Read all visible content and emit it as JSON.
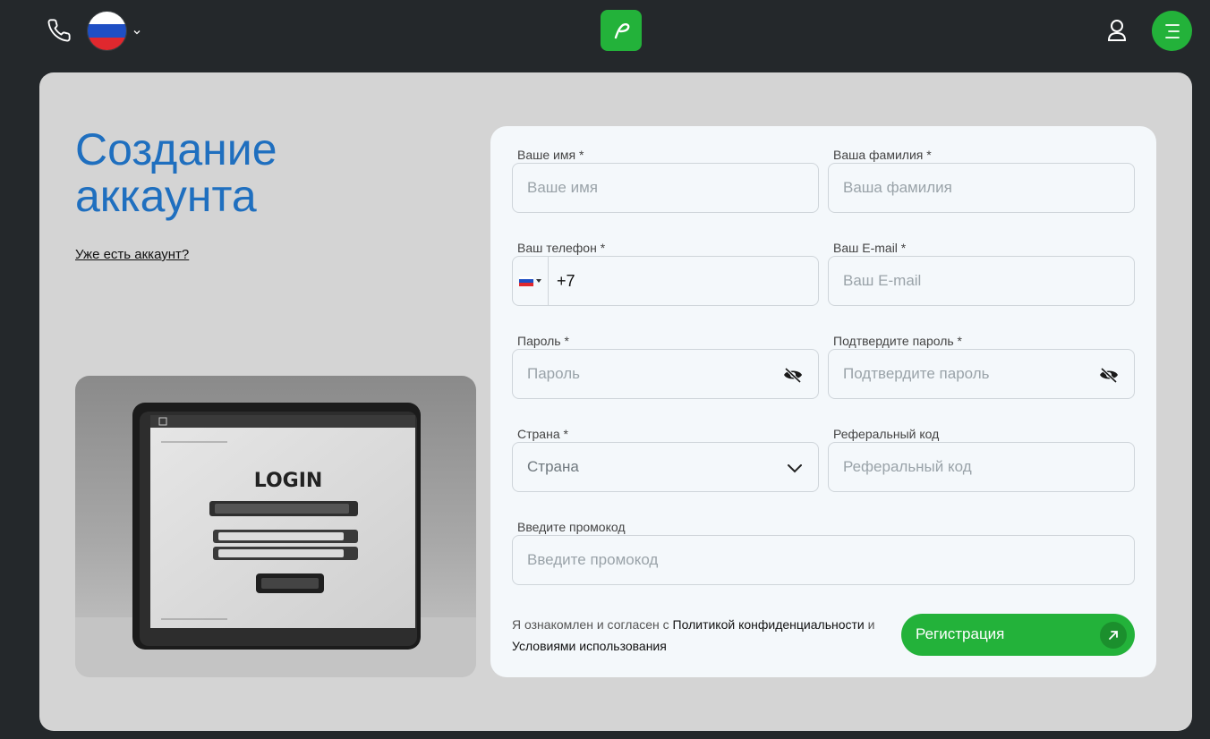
{
  "header": {
    "phone_icon": "phone-icon",
    "language_flag": "russia-flag",
    "logo_icon": "leaf-logo-icon",
    "user_icon": "user-icon",
    "menu_icon": "hamburger-menu-icon"
  },
  "page": {
    "title": "Создание аккаунта",
    "login_link": "Уже есть аккаунт?",
    "picture_text": "LOGIN"
  },
  "form": {
    "first_name": {
      "label": "Ваше имя *",
      "placeholder": "Ваше имя",
      "value": ""
    },
    "last_name": {
      "label": "Ваша фамилия *",
      "placeholder": "Ваша фамилия",
      "value": ""
    },
    "phone": {
      "label": "Ваш телефон *",
      "value": "+7",
      "country_flag": "russia-flag"
    },
    "email": {
      "label": "Ваш E-mail *",
      "placeholder": "Ваш E-mail",
      "value": ""
    },
    "password": {
      "label": "Пароль *",
      "placeholder": "Пароль",
      "value": ""
    },
    "confirm_password": {
      "label": "Подтвердите пароль *",
      "placeholder": "Подтвердите пароль",
      "value": ""
    },
    "country": {
      "label": "Страна *",
      "selected": "Страна"
    },
    "referral": {
      "label": "Реферальный код",
      "placeholder": "Реферальный код",
      "value": ""
    },
    "promo": {
      "label": "Введите промокод",
      "placeholder": "Введите промокод",
      "value": ""
    },
    "agreement": {
      "prefix": "Я ознакомлен и согласен с",
      "privacy_link": "Политикой конфиденциальности",
      "conjunction": "и",
      "terms_link": "Условиями использования"
    },
    "submit_label": "Регистрация"
  },
  "colors": {
    "background": "#24282b",
    "panel": "#d4d4d4",
    "card": "#f4f8fb",
    "accent_green": "#23b23a",
    "title_blue": "#1f6fbf"
  }
}
